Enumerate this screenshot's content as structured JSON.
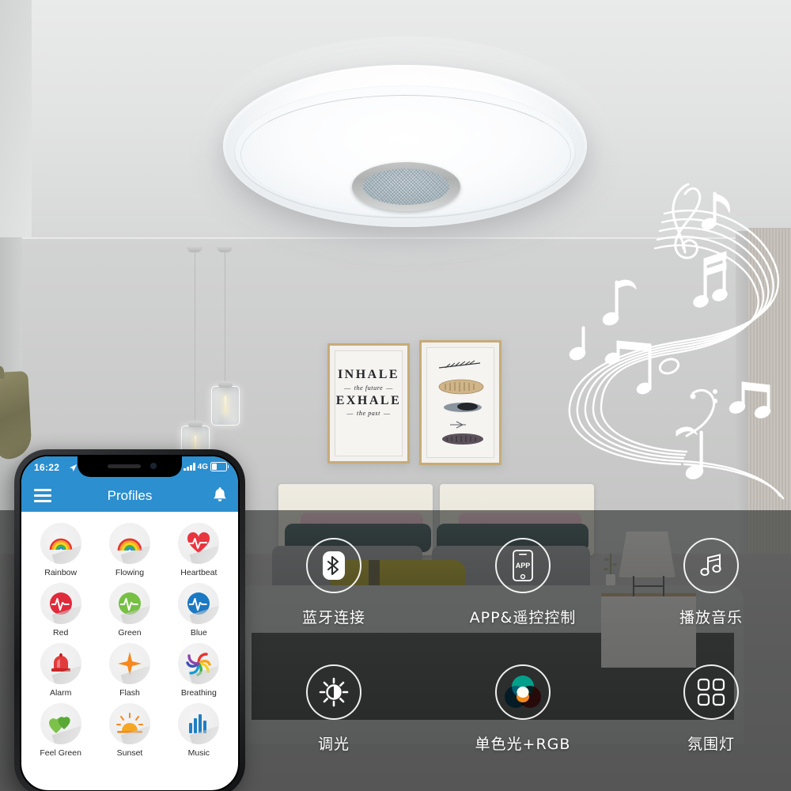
{
  "product": {
    "type": "smart-led-ceiling-lamp-with-bluetooth-speaker",
    "scene": "bedroom"
  },
  "wall_art": {
    "poster_line1": "INHALE",
    "poster_line2": "the future",
    "poster_line3": "EXHALE",
    "poster_line4": "the past",
    "second_frame": "feathers-illustration"
  },
  "phone": {
    "status_bar": {
      "time": "16:22",
      "location_icon": "location-arrow-icon",
      "signal_icon": "signal-bars-icon",
      "network": "4G",
      "battery_icon": "battery-icon"
    },
    "nav": {
      "menu_icon": "hamburger-menu-icon",
      "title": "Profiles",
      "right_icon": "bell-icon",
      "bar_color": "#2b8fd0"
    },
    "profiles": [
      {
        "label": "Rainbow",
        "icon": "rainbow-icon"
      },
      {
        "label": "Flowing",
        "icon": "rainbow-flowing-icon"
      },
      {
        "label": "Heartbeat",
        "icon": "heart-pulse-icon"
      },
      {
        "label": "Red",
        "icon": "red-pulse-icon"
      },
      {
        "label": "Green",
        "icon": "green-pulse-icon"
      },
      {
        "label": "Blue",
        "icon": "blue-pulse-icon"
      },
      {
        "label": "Alarm",
        "icon": "alarm-siren-icon"
      },
      {
        "label": "Flash",
        "icon": "flash-star-icon"
      },
      {
        "label": "Breathing",
        "icon": "color-swirl-icon"
      },
      {
        "label": "Feel Green",
        "icon": "green-hearts-icon"
      },
      {
        "label": "Sunset",
        "icon": "sunset-icon"
      },
      {
        "label": "Music",
        "icon": "music-bars-icon"
      }
    ]
  },
  "features": [
    {
      "label": "蓝牙连接",
      "icon": "bluetooth-icon"
    },
    {
      "label": "APP&遥控控制",
      "icon": "app-phone-icon"
    },
    {
      "label": "播放音乐",
      "icon": "music-note-icon"
    },
    {
      "label": "调光",
      "icon": "brightness-dimming-icon"
    },
    {
      "label": "单色光+RGB",
      "icon": "rgb-color-circles-icon"
    },
    {
      "label": "氛围灯",
      "icon": "four-squares-icon"
    }
  ],
  "app_badge": "APP",
  "colors": {
    "app_blue": "#2b8fd0",
    "overlay": "rgba(42,44,44,0.62)",
    "rgb_teal": "#00a08a",
    "rgb_blue": "#1b9ad6",
    "rgb_red": "#e8353a",
    "rgb_orange": "#f08a1e"
  }
}
